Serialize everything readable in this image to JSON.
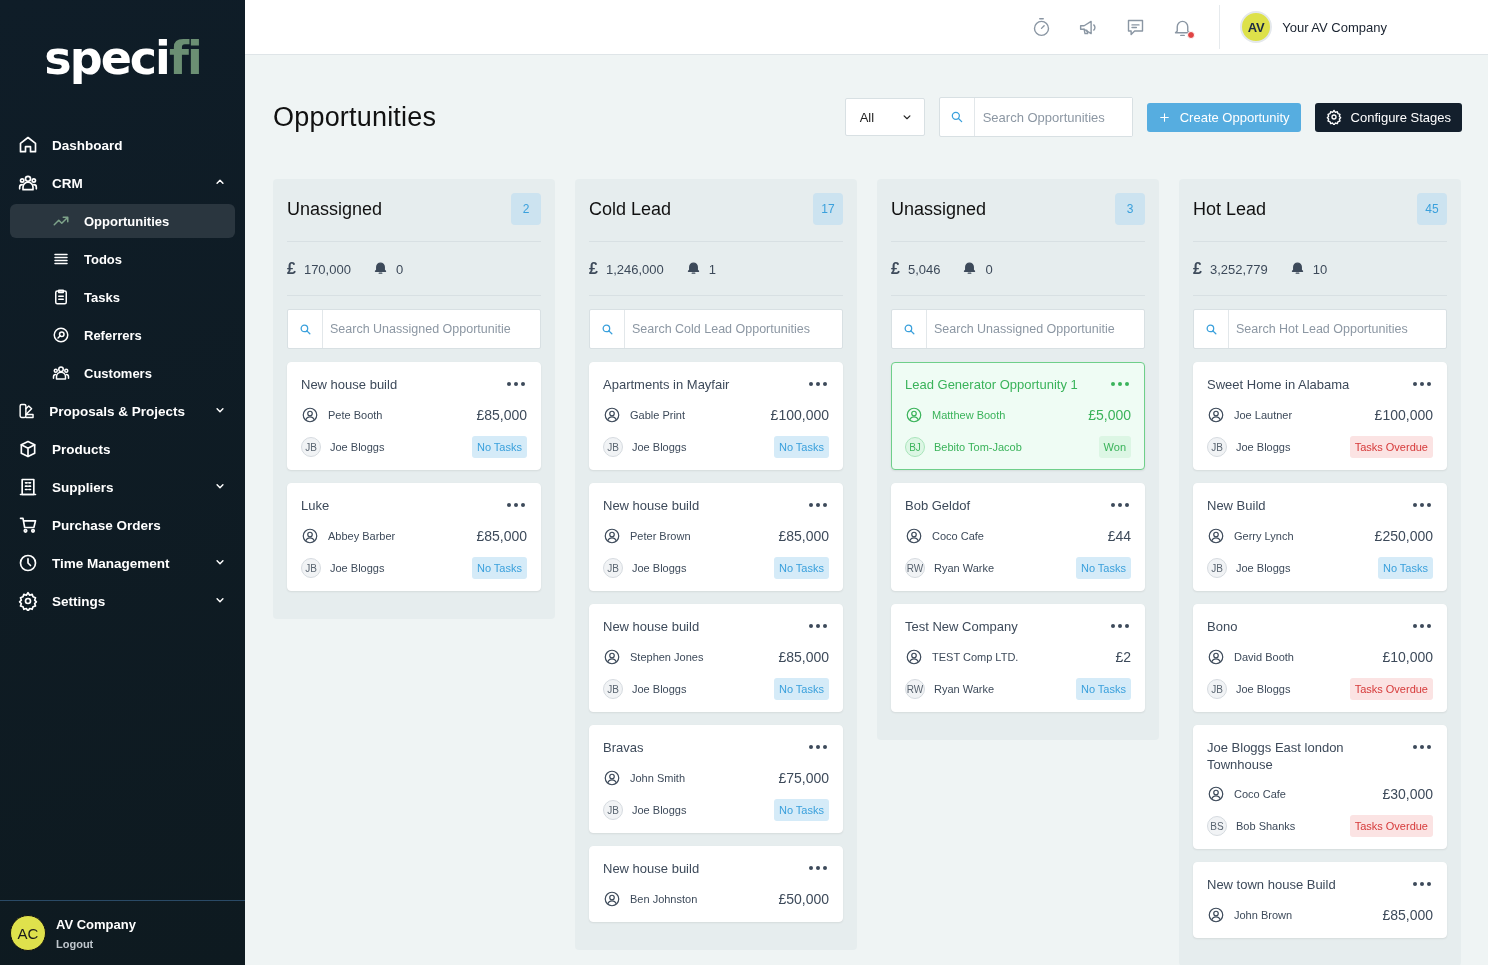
{
  "sidebar": {
    "logo": {
      "main": "speci",
      "accent": "fi"
    },
    "items": [
      {
        "label": "Dashboard"
      },
      {
        "label": "CRM",
        "expanded": true,
        "children": [
          {
            "label": "Opportunities",
            "selected": true
          },
          {
            "label": "Todos",
            "selected": false
          },
          {
            "label": "Tasks",
            "selected": false
          },
          {
            "label": "Referrers",
            "selected": false
          },
          {
            "label": "Customers",
            "selected": false
          }
        ]
      },
      {
        "label": "Proposals & Projects",
        "expanded": false
      },
      {
        "label": "Products"
      },
      {
        "label": "Suppliers",
        "expanded": false
      },
      {
        "label": "Purchase Orders"
      },
      {
        "label": "Time Management",
        "expanded": false
      },
      {
        "label": "Settings",
        "expanded": false
      }
    ],
    "user": {
      "initials": "AC",
      "name": "AV Company",
      "action": "Logout"
    }
  },
  "header": {
    "notifications_unread": true,
    "account": {
      "initials": "AV",
      "name": "Your AV Company"
    }
  },
  "page": {
    "title": "Opportunities",
    "filter": "All",
    "search": {
      "placeholder": "Search Opportunities"
    },
    "buttons": [
      {
        "label": "Create Opportunity",
        "kind": "primary"
      },
      {
        "label": "Configure Stages",
        "kind": "dark"
      }
    ]
  },
  "columns": [
    {
      "title": "Unassigned",
      "count": "2",
      "currency": "£",
      "total": "170,000",
      "alerts": "0",
      "search_placeholder": "Search Unassigned Opportunitie",
      "cards": [
        {
          "title": "New house build",
          "contact": "Pete Booth",
          "value": "£85,000",
          "owner_initials": "JB",
          "owner": "Joe Bloggs",
          "status": {
            "kind": "no_tasks",
            "label": "No Tasks"
          }
        },
        {
          "title": "Luke",
          "contact": "Abbey Barber",
          "value": "£85,000",
          "owner_initials": "JB",
          "owner": "Joe Bloggs",
          "status": {
            "kind": "no_tasks",
            "label": "No Tasks"
          }
        }
      ]
    },
    {
      "title": "Cold Lead",
      "count": "17",
      "currency": "£",
      "total": "1,246,000",
      "alerts": "1",
      "search_placeholder": "Search Cold Lead Opportunities",
      "cards": [
        {
          "title": "Apartments in Mayfair",
          "contact": "Gable Print",
          "value": "£100,000",
          "owner_initials": "JB",
          "owner": "Joe Bloggs",
          "status": {
            "kind": "no_tasks",
            "label": "No Tasks"
          }
        },
        {
          "title": "New house build",
          "contact": "Peter Brown",
          "value": "£85,000",
          "owner_initials": "JB",
          "owner": "Joe Bloggs",
          "status": {
            "kind": "no_tasks",
            "label": "No Tasks"
          }
        },
        {
          "title": "New house build",
          "contact": "Stephen Jones",
          "value": "£85,000",
          "owner_initials": "JB",
          "owner": "Joe Bloggs",
          "status": {
            "kind": "no_tasks",
            "label": "No Tasks"
          }
        },
        {
          "title": "Bravas",
          "contact": "John Smith",
          "value": "£75,000",
          "owner_initials": "JB",
          "owner": "Joe Bloggs",
          "status": {
            "kind": "no_tasks",
            "label": "No Tasks"
          }
        },
        {
          "title": "New house build",
          "contact": "Ben Johnston",
          "value": "£50,000"
        }
      ]
    },
    {
      "title": "Unassigned",
      "count": "3",
      "currency": "£",
      "total": "5,046",
      "alerts": "0",
      "search_placeholder": "Search Unassigned Opportunitie",
      "cards": [
        {
          "title": "Lead Generator Opportunity 1",
          "contact": "Matthew Booth",
          "value": "£5,000",
          "owner_initials": "BJ",
          "owner": "Bebito Tom-Jacob",
          "status": {
            "kind": "won",
            "label": "Won"
          }
        },
        {
          "title": "Bob Geldof",
          "contact": "Coco Cafe",
          "value": "£44",
          "owner_initials": "RW",
          "owner": "Ryan Warke",
          "status": {
            "kind": "no_tasks",
            "label": "No Tasks"
          }
        },
        {
          "title": "Test New Company",
          "contact": "TEST Comp LTD.",
          "value": "£2",
          "owner_initials": "RW",
          "owner": "Ryan Warke",
          "status": {
            "kind": "no_tasks",
            "label": "No Tasks"
          }
        }
      ]
    },
    {
      "title": "Hot Lead",
      "count": "45",
      "currency": "£",
      "total": "3,252,779",
      "alerts": "10",
      "search_placeholder": "Search Hot Lead Opportunities",
      "cards": [
        {
          "title": "Sweet Home in Alabama",
          "contact": "Joe Lautner",
          "value": "£100,000",
          "owner_initials": "JB",
          "owner": "Joe Bloggs",
          "status": {
            "kind": "overdue",
            "label": "Tasks Overdue"
          }
        },
        {
          "title": "New Build",
          "contact": "Gerry Lynch",
          "value": "£250,000",
          "owner_initials": "JB",
          "owner": "Joe Bloggs",
          "status": {
            "kind": "no_tasks",
            "label": "No Tasks"
          }
        },
        {
          "title": "Bono",
          "contact": "David Booth",
          "value": "£10,000",
          "owner_initials": "JB",
          "owner": "Joe Bloggs",
          "status": {
            "kind": "overdue",
            "label": "Tasks Overdue"
          }
        },
        {
          "title": "Joe Bloggs East london Townhouse",
          "contact": "Coco Cafe",
          "value": "£30,000",
          "owner_initials": "BS",
          "owner": "Bob Shanks",
          "status": {
            "kind": "overdue",
            "label": "Tasks Overdue"
          }
        },
        {
          "title": "New town house Build",
          "contact": "John Brown",
          "value": "£85,000"
        }
      ]
    }
  ]
}
